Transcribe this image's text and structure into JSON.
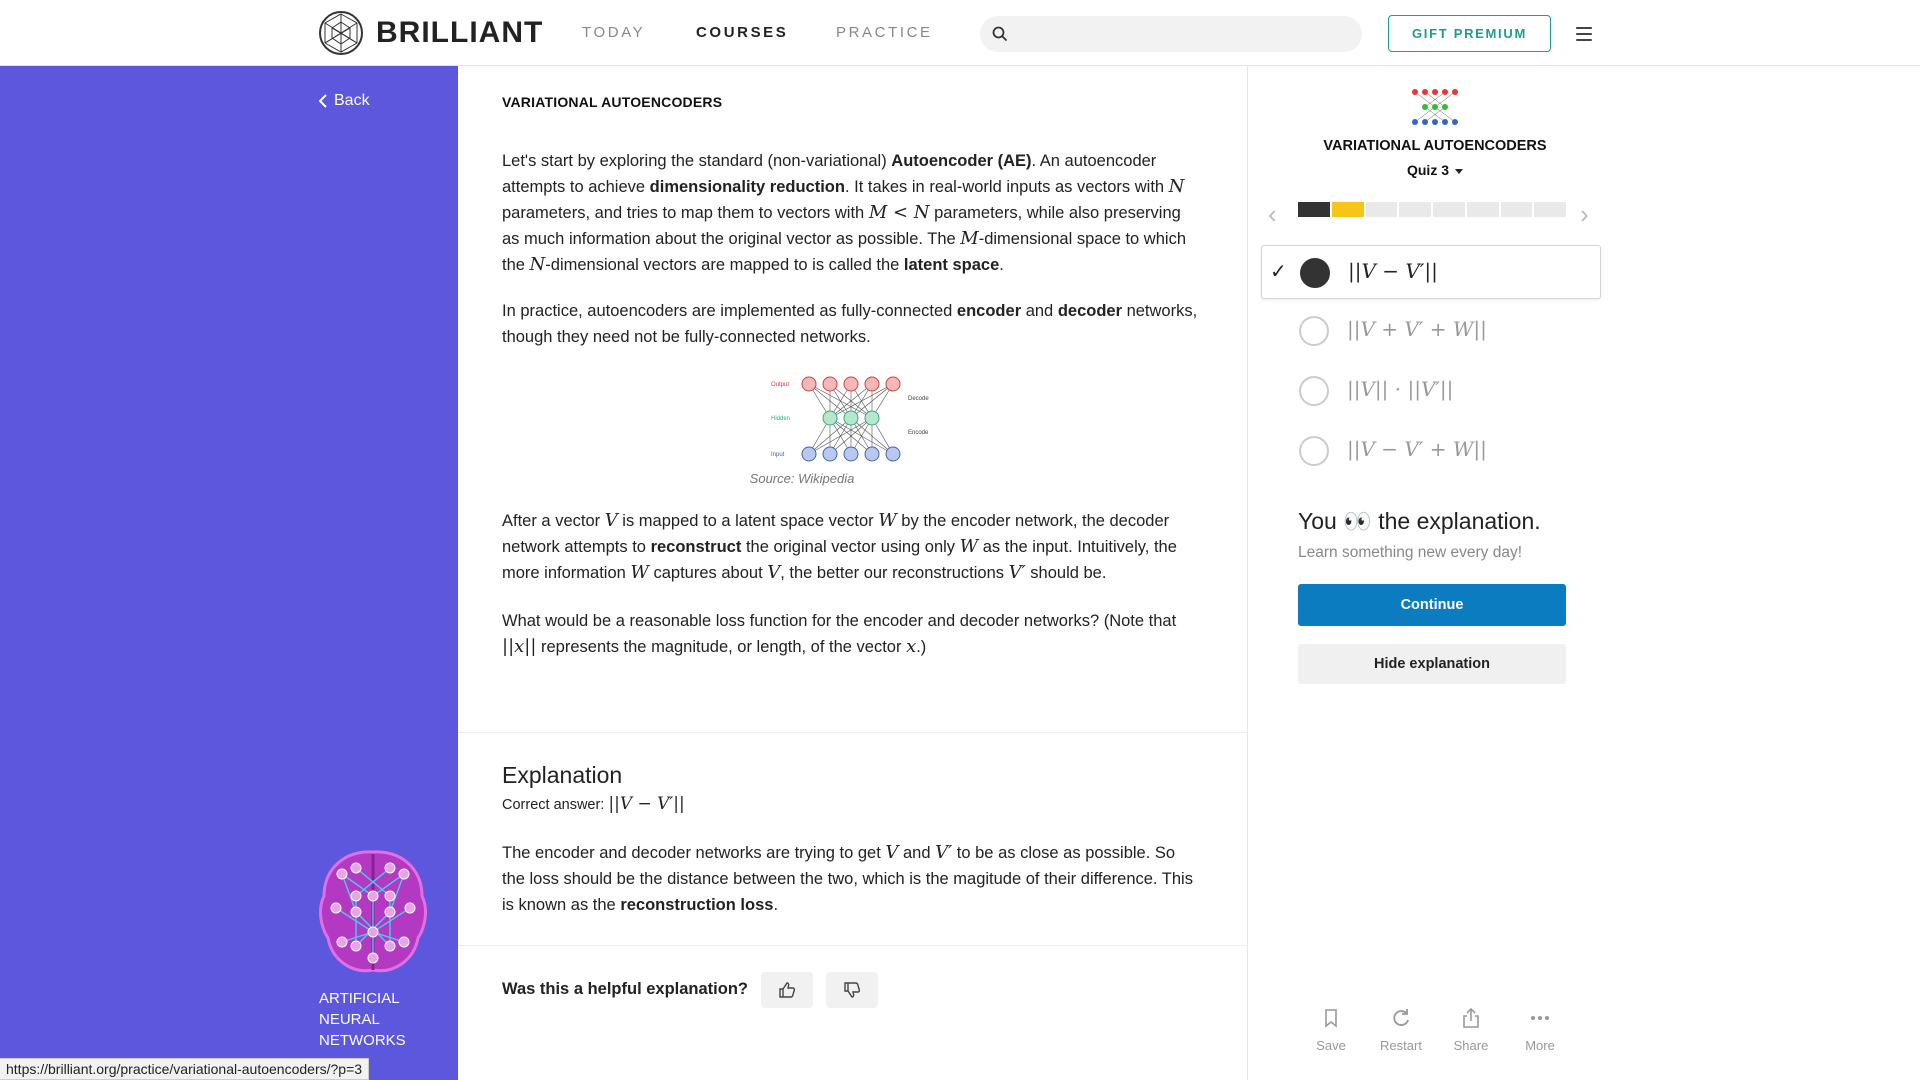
{
  "nav": {
    "brand": "BRILLIANT",
    "links": [
      "TODAY",
      "COURSES",
      "PRACTICE"
    ],
    "active_link": "COURSES",
    "search_placeholder": "",
    "gift_label": "GIFT PREMIUM"
  },
  "sidebar": {
    "back_label": "Back",
    "course_name": "ARTIFICIAL NEURAL NETWORKS"
  },
  "content": {
    "section_title": "VARIATIONAL AUTOENCODERS",
    "p1_a": "Let's start by exploring the standard (non-variational) ",
    "p1_b_bold": "Autoencoder (AE)",
    "p1_c": ". An autoencoder attempts to achieve ",
    "p1_d_bold": "dimensionality reduction",
    "p1_e": ". It takes in real-world inputs as vectors with ",
    "p1_f_math": "N",
    "p1_g": " parameters, and tries to map them to vectors with ",
    "p1_h_math": "M < N",
    "p1_i": " parameters, while also preserving as much information about the original vector as possible. The ",
    "p1_j_math": "M",
    "p1_k": "-dimensional space to which the ",
    "p1_l_math": "N",
    "p1_m": "-dimensional vectors are mapped to is called the ",
    "p1_n_bold": "latent space",
    "p1_o": ".",
    "p2_a": "In practice, autoencoders are implemented as fully-connected ",
    "p2_b_bold": "encoder",
    "p2_c": " and ",
    "p2_d_bold": "decoder",
    "p2_e": " networks, though they need not be fully-connected networks.",
    "figure_labels": {
      "output": "Output",
      "hidden": "Hidden",
      "input": "Input",
      "decode": "Decode",
      "encode": "Encode"
    },
    "figure_caption": "Source: Wikipedia",
    "p3_a": "After a vector ",
    "p3_b_math": "V",
    "p3_c": " is mapped to a latent space vector ",
    "p3_d_math": "W",
    "p3_e": " by the encoder network, the decoder network attempts to ",
    "p3_f_bold": "reconstruct",
    "p3_g": " the original vector using only ",
    "p3_h_math": "W",
    "p3_i": " as the input. Intuitively, the more information ",
    "p3_j_math": "W",
    "p3_k": " captures about ",
    "p3_l_math": "V",
    "p3_m": ", the better our reconstructions ",
    "p3_n_math": "V′",
    "p3_o": " should be.",
    "p4_a": "What would be a reasonable loss function for the encoder and decoder networks? (Note that ",
    "p4_b_math": "||x||",
    "p4_c": " represents the magnitude, or length, of the vector ",
    "p4_d_math": "x",
    "p4_e": ".)"
  },
  "explanation": {
    "title": "Explanation",
    "correct_label": "Correct answer: ",
    "correct_math": "||V − V′||",
    "e_a": "The encoder and decoder networks are trying to get ",
    "e_b_math": "V",
    "e_c": " and ",
    "e_d_math": "V′",
    "e_e": " to be as close as possible. So the loss should be the distance between the two, which is the magitude of their difference. This is known as the ",
    "e_f_bold": "reconstruction loss",
    "e_g": ".",
    "helpful_question": "Was this a helpful explanation?"
  },
  "quiz": {
    "title": "VARIATIONAL AUTOENCODERS",
    "selector": "Quiz 3",
    "progress": {
      "total": 8,
      "completed": 1,
      "current_index": 1
    },
    "options": [
      {
        "label": "||V − V′||",
        "selected": true
      },
      {
        "label": "||V + V′ + W||",
        "selected": false
      },
      {
        "label": "||V|| · ||V′||",
        "selected": false
      },
      {
        "label": "||V − V′ + W||",
        "selected": false
      }
    ],
    "result_a": "You ",
    "result_emoji": "👀",
    "result_b": " the explanation.",
    "subtitle": "Learn something new every day!",
    "continue_label": "Continue",
    "hide_label": "Hide explanation",
    "actions": [
      {
        "label": "Save",
        "icon": "bookmark-icon"
      },
      {
        "label": "Restart",
        "icon": "restart-icon"
      },
      {
        "label": "Share",
        "icon": "share-icon"
      },
      {
        "label": "More",
        "icon": "more-icon"
      }
    ]
  },
  "status_url": "https://brilliant.org/practice/variational-autoencoders/?p=3",
  "colors": {
    "sidebar_bg": "#5c57dd",
    "accent_teal": "#1e9e8a",
    "continue_blue": "#0c7cc0",
    "progress_current": "#f5c518"
  }
}
